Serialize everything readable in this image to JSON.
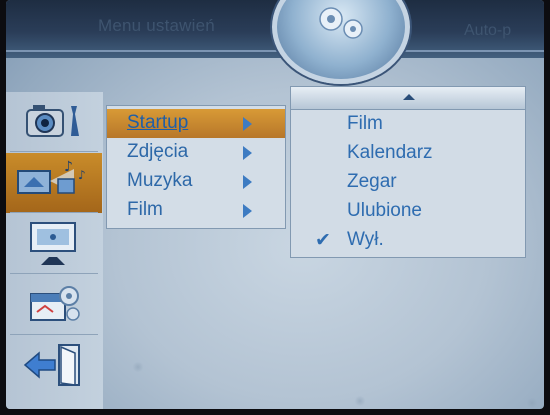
{
  "header": {
    "title": "Menu ustawień",
    "mode": "Auto-p"
  },
  "sidebar": {
    "items": [
      {
        "icon": "camera-wrench-icon"
      },
      {
        "icon": "photo-music-slideshow-icon",
        "active": true
      },
      {
        "icon": "display-icon"
      },
      {
        "icon": "calendar-gear-icon"
      },
      {
        "icon": "exit-arrow-icon"
      }
    ]
  },
  "submenu": {
    "items": [
      {
        "label": "Startup",
        "active": true
      },
      {
        "label": "Zdjęcia"
      },
      {
        "label": "Muzyka"
      },
      {
        "label": "Film"
      }
    ]
  },
  "dropdown": {
    "options": [
      {
        "label": "Film"
      },
      {
        "label": "Kalendarz"
      },
      {
        "label": "Zegar"
      },
      {
        "label": "Ulubione"
      },
      {
        "label": "Wył.",
        "checked": true
      }
    ]
  },
  "colors": {
    "accent": "#c98c2a",
    "text": "#2e6cb0"
  }
}
